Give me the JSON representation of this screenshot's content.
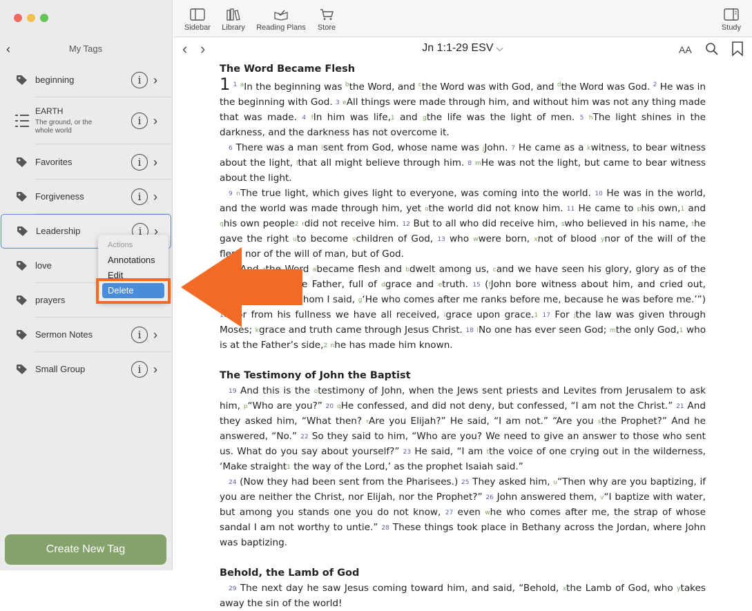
{
  "window": {
    "traffic_colors": [
      "#ec6a5e",
      "#f4bf4f",
      "#61c554"
    ]
  },
  "sidebar": {
    "title": "My Tags",
    "tags": [
      {
        "label": "beginning"
      },
      {
        "label": "EARTH",
        "sub": "The ground, or the whole world"
      },
      {
        "label": "Favorites"
      },
      {
        "label": "Forgiveness"
      },
      {
        "label": "Leadership",
        "selected": true
      },
      {
        "label": "love"
      },
      {
        "label": "prayers"
      },
      {
        "label": "Sermon Notes"
      },
      {
        "label": "Small Group"
      }
    ],
    "create_button": "Create New Tag"
  },
  "context_menu": {
    "header": "Actions",
    "items": [
      "Annotations",
      "Edit",
      "Delete"
    ],
    "highlighted": "Delete"
  },
  "toolbar": {
    "sidebar": "Sidebar",
    "library": "Library",
    "reading_plans": "Reading Plans",
    "store": "Store",
    "study": "Study"
  },
  "nav": {
    "reference": "Jn 1:1-29 ESV",
    "text_size": "AA"
  },
  "reader": {
    "heading1": "The Word Became Flesh",
    "heading2": "The Testimony of John the Baptist",
    "heading3": "Behold, the Lamb of God"
  },
  "colors": {
    "accent": "#4a8bdc",
    "create_button": "#84a26a",
    "annotation_orange": "#f26b26"
  }
}
